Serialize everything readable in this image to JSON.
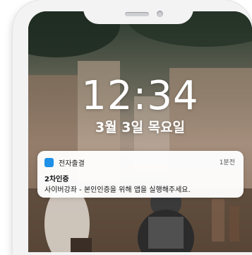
{
  "lock_screen": {
    "time": "12:34",
    "date": "3월 3일 목요일"
  },
  "notification": {
    "app_icon": "app-icon",
    "app_name": "전자출결",
    "time_ago": "1분전",
    "title": "2차인증",
    "body": "사이버강좌 - 본인인증을 위해 앱을 실행해주세요."
  },
  "colors": {
    "accent": "#1e90e8",
    "frame": "#f3f3f4",
    "clock_text": "#ffffff"
  }
}
